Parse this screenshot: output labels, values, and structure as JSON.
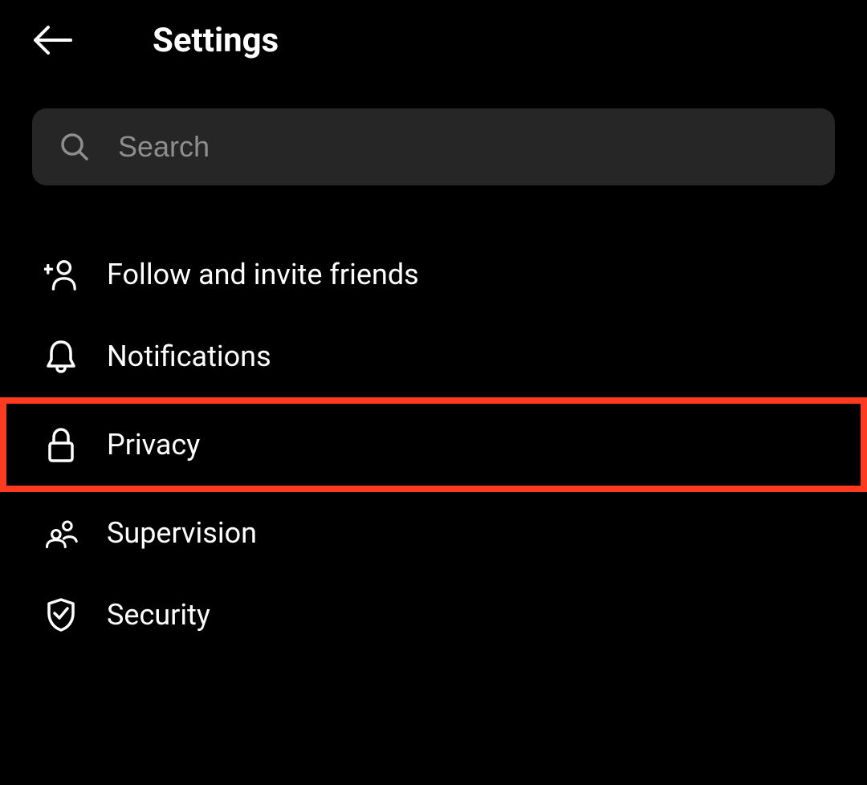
{
  "header": {
    "title": "Settings"
  },
  "search": {
    "placeholder": "Search"
  },
  "items": [
    {
      "label": "Follow and invite friends",
      "icon": "add-person-icon",
      "highlighted": false
    },
    {
      "label": "Notifications",
      "icon": "bell-icon",
      "highlighted": false
    },
    {
      "label": "Privacy",
      "icon": "lock-icon",
      "highlighted": true
    },
    {
      "label": "Supervision",
      "icon": "people-icon",
      "highlighted": false
    },
    {
      "label": "Security",
      "icon": "shield-check-icon",
      "highlighted": false
    }
  ]
}
